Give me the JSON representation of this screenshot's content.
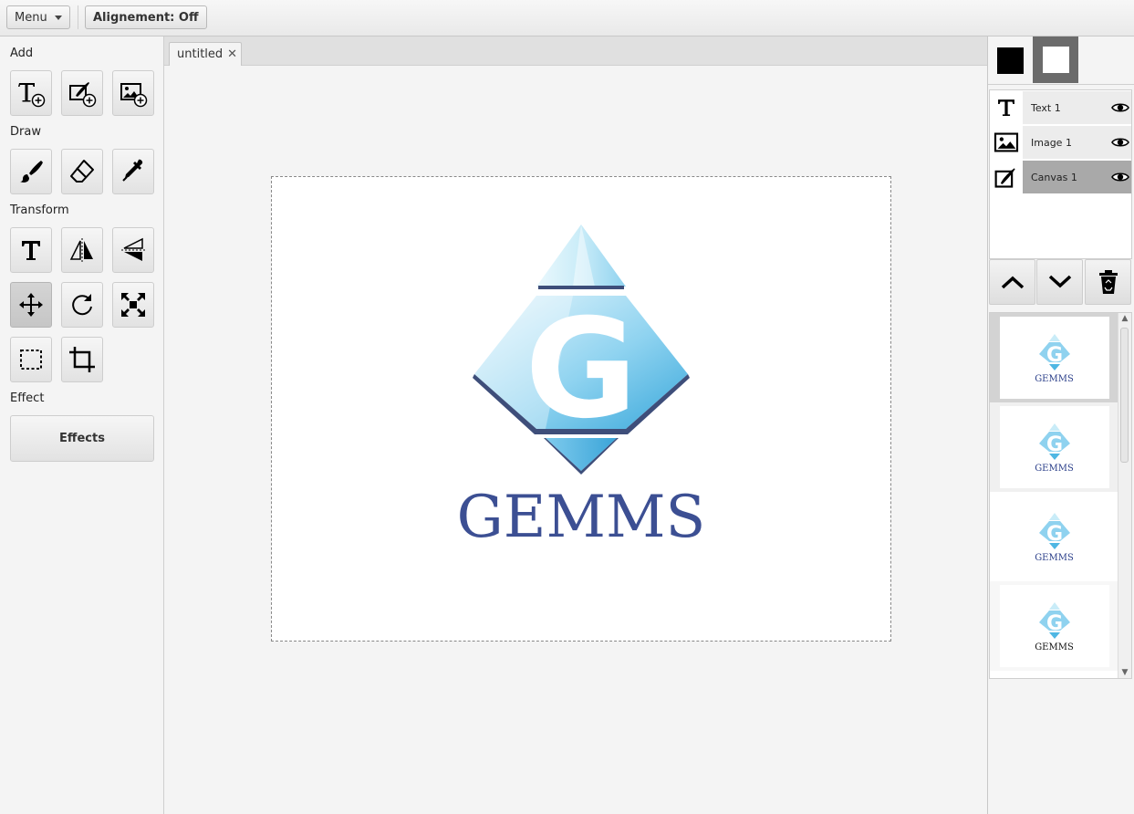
{
  "toolbar": {
    "menu_label": "Menu",
    "alignment_label": "Alignement: Off"
  },
  "left": {
    "sections": {
      "add": "Add",
      "draw": "Draw",
      "transform": "Transform",
      "effect": "Effect"
    },
    "effects_button": "Effects"
  },
  "tabs": [
    {
      "label": "untitled",
      "close": "✕"
    }
  ],
  "canvas_content": {
    "logo_letter": "G",
    "logo_text": "GEMMS"
  },
  "colors": {
    "foreground": "#000000",
    "background": "#ffffff",
    "logo_text": "#3c4f93",
    "gem_light": "#c9ecf8",
    "gem_dark": "#4fb7e3"
  },
  "layers": [
    {
      "name": "Text 1",
      "icon": "text-layer-icon"
    },
    {
      "name": "Image 1",
      "icon": "image-layer-icon"
    },
    {
      "name": "Canvas 1",
      "icon": "canvas-layer-icon",
      "selected": true
    }
  ],
  "history": [
    {
      "label": "GEMMS"
    },
    {
      "label": "GEMMS"
    },
    {
      "label": "GEMMS"
    },
    {
      "label": "GEMMS"
    }
  ]
}
